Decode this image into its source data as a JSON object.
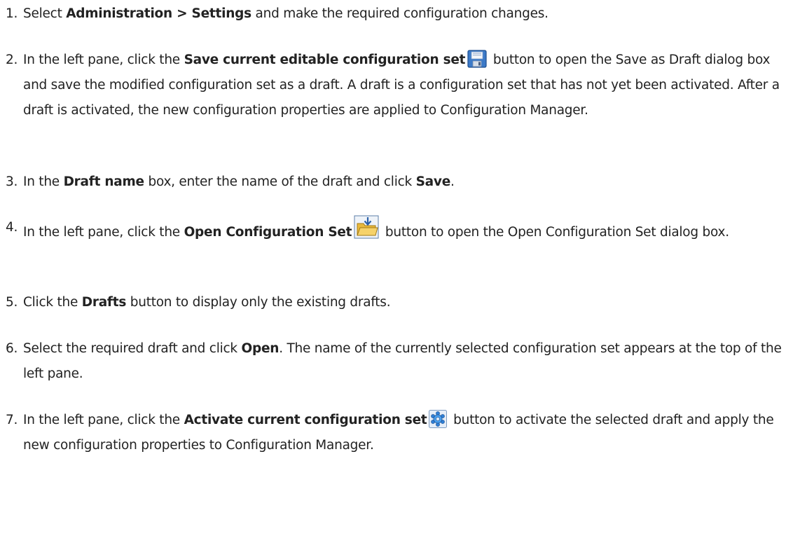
{
  "steps": [
    {
      "num": "1.",
      "a": "Select ",
      "b1": "Administration > Settings",
      "c": " and make the required configuration changes."
    },
    {
      "num": "2.",
      "a": "In the left pane, click the ",
      "b1": "Save current editable configuration set",
      "icon": "save-floppy-icon",
      "c": " button to open the Save as Draft dialog box and save the modified configuration set as a draft. A draft is a configuration set that has not yet been activated. After a draft is activated, the new configuration properties are applied to Configuration Manager."
    },
    {
      "num": "3.",
      "a": "In the ",
      "b1": "Draft name",
      "c": " box, enter the name of the draft and click ",
      "b2": "Save",
      "d": "."
    },
    {
      "num": "4.",
      "a": "In the left pane, click the ",
      "b1": "Open Configuration Set",
      "icon": "open-folder-icon",
      "c": " button to open the Open Configuration Set dialog box."
    },
    {
      "num": "5.",
      "a": "Click the ",
      "b1": "Drafts",
      "c": " button to display only the existing drafts."
    },
    {
      "num": "6.",
      "a": "Select the required draft and click ",
      "b1": "Open",
      "c": ". The name of the currently selected configuration set appears at the top of the left pane."
    },
    {
      "num": "7.",
      "a": "In the left pane, click the ",
      "b1": "Activate current configuration set",
      "icon": "activate-gear-icon",
      "c": " button to activate the selected draft and apply the new configuration properties to Configuration Manager."
    }
  ]
}
